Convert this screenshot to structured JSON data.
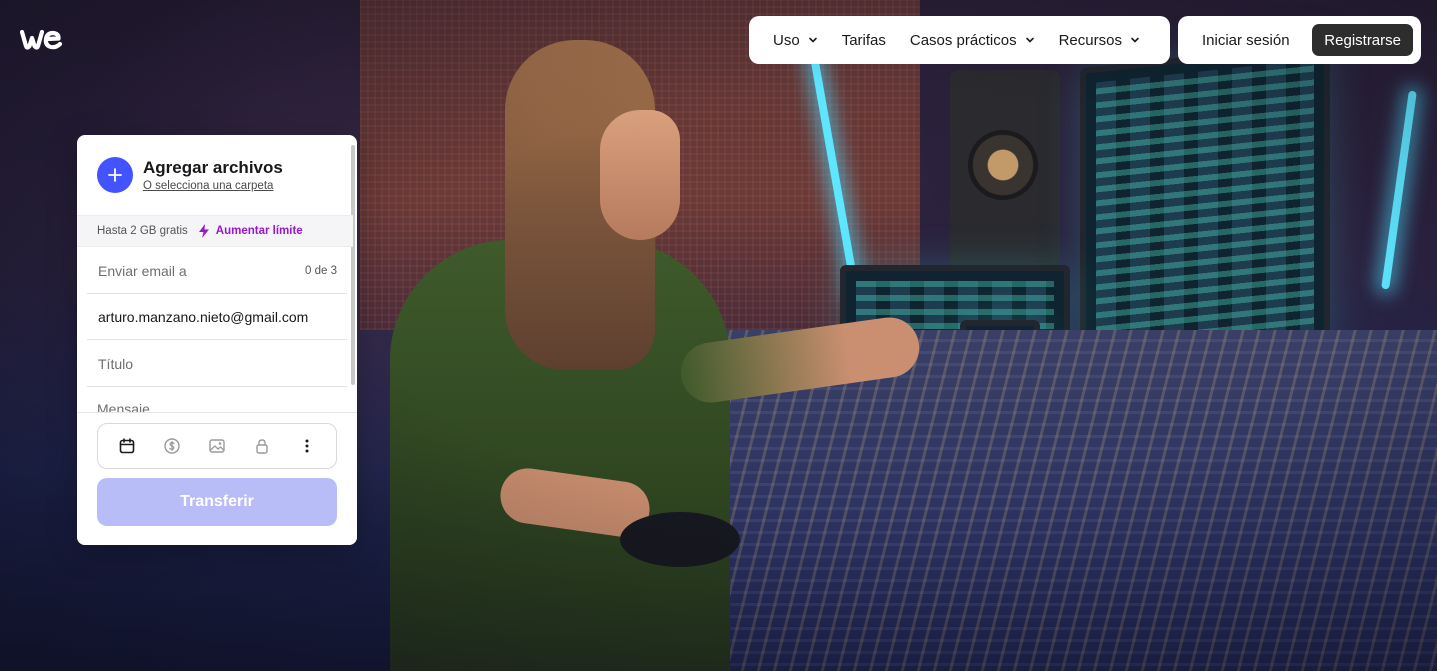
{
  "brand": {
    "logo_icon": "wetransfer-logo-icon"
  },
  "nav": {
    "items": [
      {
        "label": "Uso",
        "has_dropdown": true
      },
      {
        "label": "Tarifas",
        "has_dropdown": false
      },
      {
        "label": "Casos prácticos",
        "has_dropdown": true
      },
      {
        "label": "Recursos",
        "has_dropdown": true
      }
    ],
    "login_label": "Iniciar sesión",
    "signup_label": "Registrarse"
  },
  "upload": {
    "add_title": "Agregar archivos",
    "add_subtitle": "O selecciona una carpeta",
    "limit_text": "Hasta 2 GB gratis",
    "limit_upgrade": "Aumentar límite",
    "email_placeholder": "Enviar email a",
    "email_count": "0 de 3",
    "your_email_value": "arturo.manzano.nieto@gmail.com",
    "title_placeholder": "Título",
    "message_placeholder": "Mensaje",
    "tools": [
      "calendar-icon",
      "dollar-icon",
      "image-icon",
      "lock-icon",
      "more-vertical-icon"
    ],
    "transfer_label": "Transferir"
  },
  "colors": {
    "accent": "#4353ff",
    "upgrade": "#9a18c8",
    "transfer_disabled": "#b8bcf7",
    "signup_bg": "#2d2d2d"
  }
}
